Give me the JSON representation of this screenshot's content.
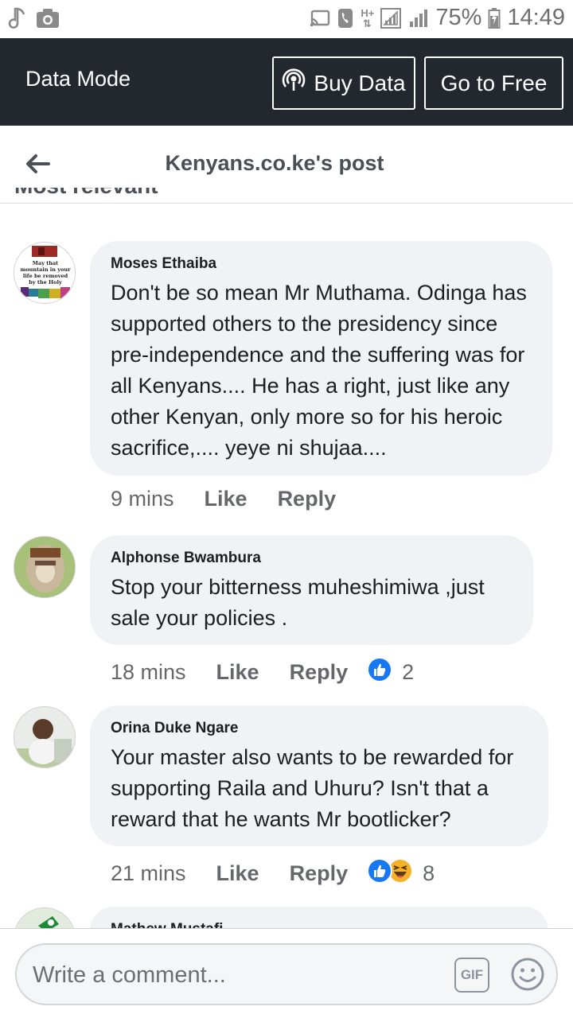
{
  "status_bar": {
    "battery": "75%",
    "time": "14:49",
    "network": "H+"
  },
  "data_bar": {
    "label": "Data Mode",
    "buy_data": "Buy Data",
    "go_free": "Go to Free"
  },
  "header": {
    "title": "Kenyans.co.ke's post",
    "sort_partial": "Most relevant"
  },
  "comments": [
    {
      "author": "Moses Ethaiba",
      "text": "Don't be so mean Mr Muthama. Odinga has supported others to the presidency since pre-independence and the suffering was for all Kenyans.... He has a right, just like any other Kenyan, only more so for his heroic sacrifice,.... yeye ni shujaa....",
      "avatar_text": [
        "May that",
        "mountain in your",
        "life be removed",
        "by the Holy"
      ],
      "time": "9 mins",
      "like": "Like",
      "reply": "Reply",
      "reactions": "",
      "reaction_icons": []
    },
    {
      "author": "Alphonse Bwambura",
      "text": "Stop your bitterness muheshimiwa ,just sale your policies .",
      "time": "18 mins",
      "like": "Like",
      "reply": "Reply",
      "reactions": "2",
      "reaction_icons": [
        "like-icon"
      ]
    },
    {
      "author": "Orina Duke Ngare",
      "text": "Your master also wants to be rewarded for supporting Raila and Uhuru? Isn't that a reward that he wants Mr bootlicker?",
      "time": "21 mins",
      "like": "Like",
      "reply": "Reply",
      "reactions": "8",
      "reaction_icons": [
        "like-icon",
        "haha-icon"
      ]
    },
    {
      "author": "Mathew Mustafi",
      "text": "",
      "time": "",
      "like": "",
      "reply": "",
      "reactions": "",
      "reaction_icons": []
    }
  ],
  "composer": {
    "placeholder": "Write a comment...",
    "gif_label": "GIF"
  },
  "colors": {
    "data_bar_bg": "#23272e",
    "bubble_bg": "#f0f2f5",
    "like_blue": "#1877f2",
    "haha_yellow": "#f7b125"
  }
}
